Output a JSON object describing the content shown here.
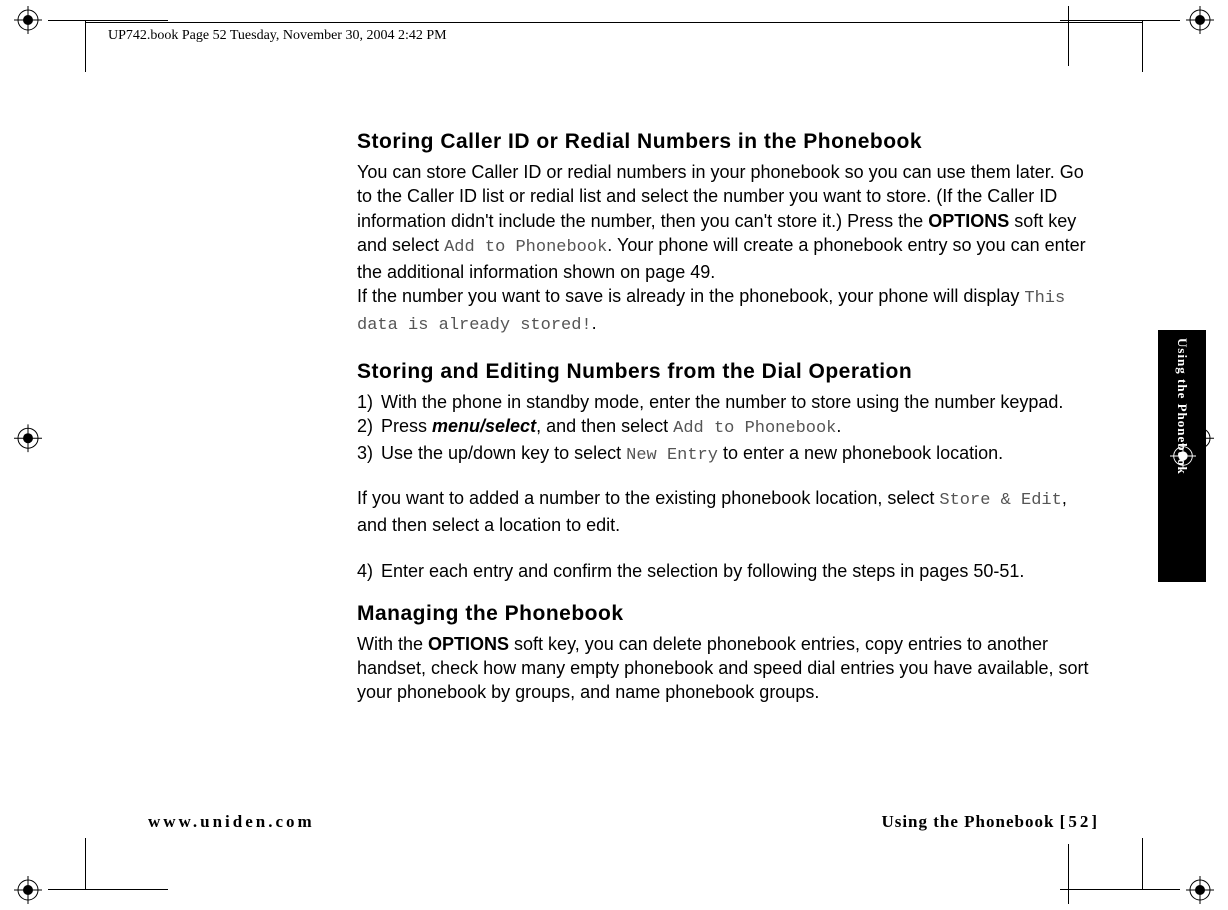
{
  "header": "UP742.book  Page 52  Tuesday, November 30, 2004  2:42 PM",
  "sideTab": "Using the Phonebook",
  "sections": {
    "s1": {
      "title": "Storing Caller ID or Redial Numbers in the Phonebook",
      "p1a": "You can store Caller ID or redial numbers in your phonebook so you can use them later. Go to the Caller ID list or redial list and select the number you want to store. (If the Caller ID information didn't include the number, then you can't store it.) Press the ",
      "options": "OPTIONS",
      "p1b": " soft key and select ",
      "lcd1": "Add to Phonebook",
      "p1c": ". Your phone will create a phonebook entry so you can enter the additional information shown on page 49.",
      "p2a": "If the number you want to save is already in the phonebook, your phone will display ",
      "lcd2": "This data is already stored!",
      "p2b": "."
    },
    "s2": {
      "title": "Storing and Editing Numbers from the Dial Operation",
      "step1": "With the phone in standby mode, enter the number to store using the number keypad.",
      "step2a": "Press ",
      "menusel": "menu/select",
      "step2b": ", and then select ",
      "lcd1": "Add to Phonebook",
      "step2c": ".",
      "step3a": "Use the up/down key to select ",
      "lcd2": "New Entry",
      "step3b": " to enter a new phonebook location.",
      "midA": "If you want to added a number to the existing phonebook location, select ",
      "lcd3": "Store & Edit",
      "midB": ", and then select a location to edit.",
      "step4": "Enter each entry and confirm the selection by following the steps in pages 50-51.",
      "n1": "1)",
      "n2": "2)",
      "n3": "3)",
      "n4": "4)"
    },
    "s3": {
      "title": "Managing the Phonebook",
      "p1a": "With the ",
      "options": "OPTIONS",
      "p1b": " soft key, you can delete phonebook entries, copy entries to another handset, check how many empty phonebook and speed dial entries you have available, sort your phonebook by groups, and name phonebook groups."
    }
  },
  "footer": {
    "left": "www.uniden.com",
    "rightLabel": "Using the Phonebook ",
    "rightPage": "[52]"
  }
}
